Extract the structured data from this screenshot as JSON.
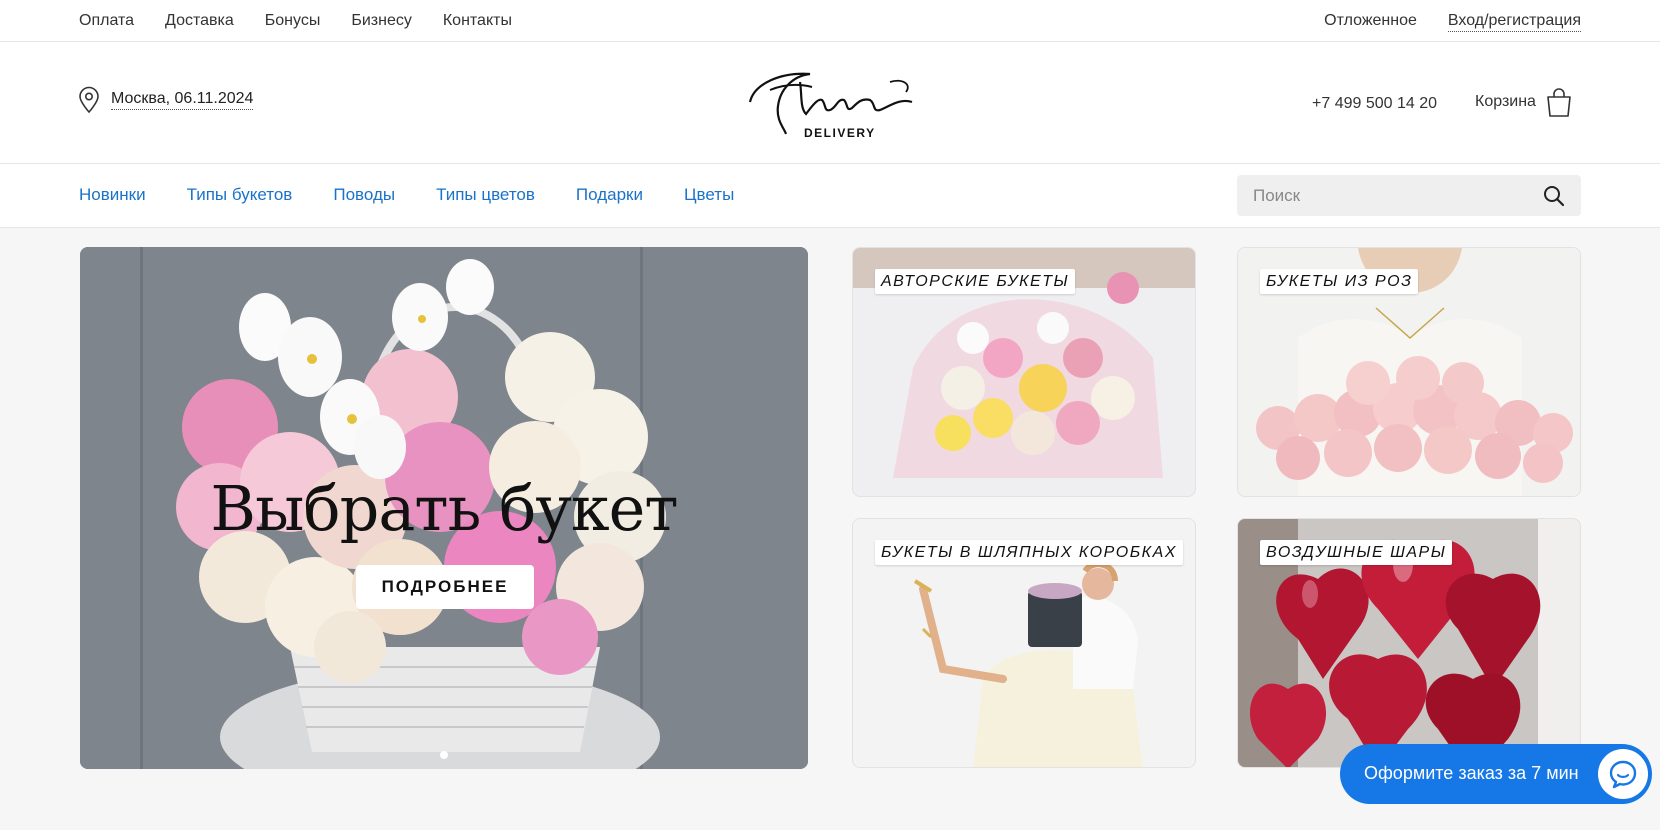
{
  "topbar": {
    "left_links": [
      "Оплата",
      "Доставка",
      "Бонусы",
      "Бизнесу",
      "Контакты"
    ],
    "deferred": "Отложенное",
    "login": "Вход/регистрация"
  },
  "header": {
    "location": "Москва, 06.11.2024",
    "logo_script": "Flora",
    "logo_sub": "DELIVERY",
    "phone": "+7 499 500 14 20",
    "cart_label": "Корзина"
  },
  "nav": {
    "items": [
      "Новинки",
      "Типы букетов",
      "Поводы",
      "Типы цветов",
      "Подарки",
      "Цветы"
    ],
    "search_placeholder": "Поиск"
  },
  "hero": {
    "title": "Выбрать букет",
    "button": "ПОДРОБНЕЕ"
  },
  "cards": [
    {
      "label": "АВТОРСКИЕ БУКЕТЫ"
    },
    {
      "label": "БУКЕТЫ ИЗ РОЗ"
    },
    {
      "label": "БУКЕТЫ В ШЛЯПНЫХ КОРОБКАХ"
    },
    {
      "label": "ВОЗДУШНЫЕ ШАРЫ"
    }
  ],
  "chat": {
    "label": "Оформите заказ за 7 мин"
  },
  "colors": {
    "nav_link": "#1a73c9",
    "chat_bg": "#1677e6"
  }
}
